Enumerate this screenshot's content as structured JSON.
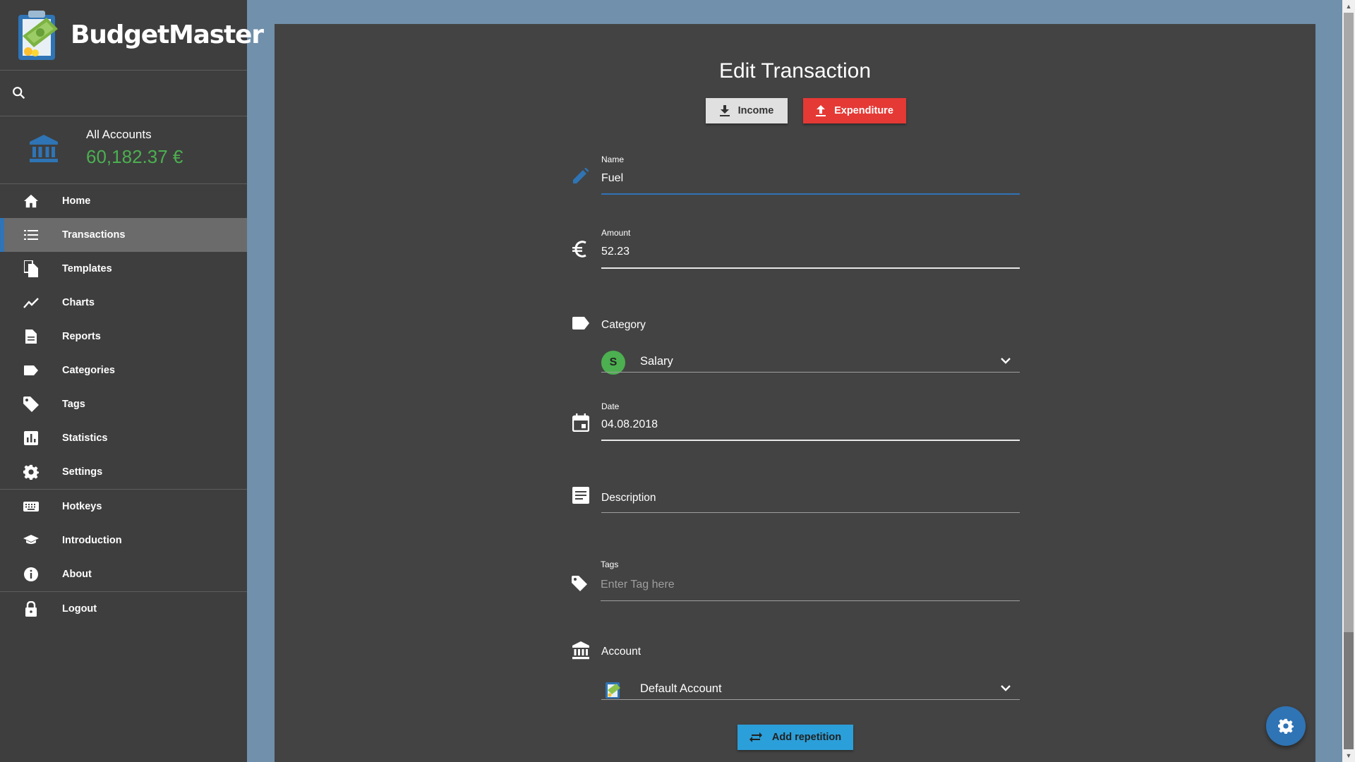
{
  "app": {
    "name": "BudgetMaster"
  },
  "sidebar": {
    "account": {
      "name": "All Accounts",
      "balance": "60,182.37 €"
    },
    "nav": [
      {
        "label": "Home",
        "icon": "home-icon"
      },
      {
        "label": "Transactions",
        "icon": "list-icon",
        "active": true
      },
      {
        "label": "Templates",
        "icon": "file-copy-icon"
      },
      {
        "label": "Charts",
        "icon": "line-chart-icon"
      },
      {
        "label": "Reports",
        "icon": "document-icon"
      },
      {
        "label": "Categories",
        "icon": "label-icon"
      },
      {
        "label": "Tags",
        "icon": "tag-icon"
      },
      {
        "label": "Statistics",
        "icon": "bar-chart-icon"
      },
      {
        "label": "Settings",
        "icon": "gear-icon"
      },
      {
        "label": "Hotkeys",
        "icon": "keyboard-icon"
      },
      {
        "label": "Introduction",
        "icon": "school-icon"
      },
      {
        "label": "About",
        "icon": "info-icon"
      },
      {
        "label": "Logout",
        "icon": "lock-icon"
      }
    ]
  },
  "form": {
    "title": "Edit Transaction",
    "income_label": "Income",
    "expenditure_label": "Expenditure",
    "name": {
      "label": "Name",
      "value": "Fuel"
    },
    "amount": {
      "label": "Amount",
      "value": "52.23"
    },
    "category": {
      "label": "Category",
      "badge": "S",
      "value": "Salary",
      "badge_color": "#4caf50"
    },
    "date": {
      "label": "Date",
      "value": "04.08.2018"
    },
    "description": {
      "label": "Description"
    },
    "tags": {
      "label": "Tags",
      "placeholder": "Enter Tag here"
    },
    "account": {
      "label": "Account",
      "value": "Default Account"
    },
    "add_repetition_label": "Add repetition"
  },
  "colors": {
    "accent": "#2f74b5",
    "income_positive": "#4caf50",
    "expenditure": "#e53935",
    "repetition_button": "#2b9fd9"
  }
}
